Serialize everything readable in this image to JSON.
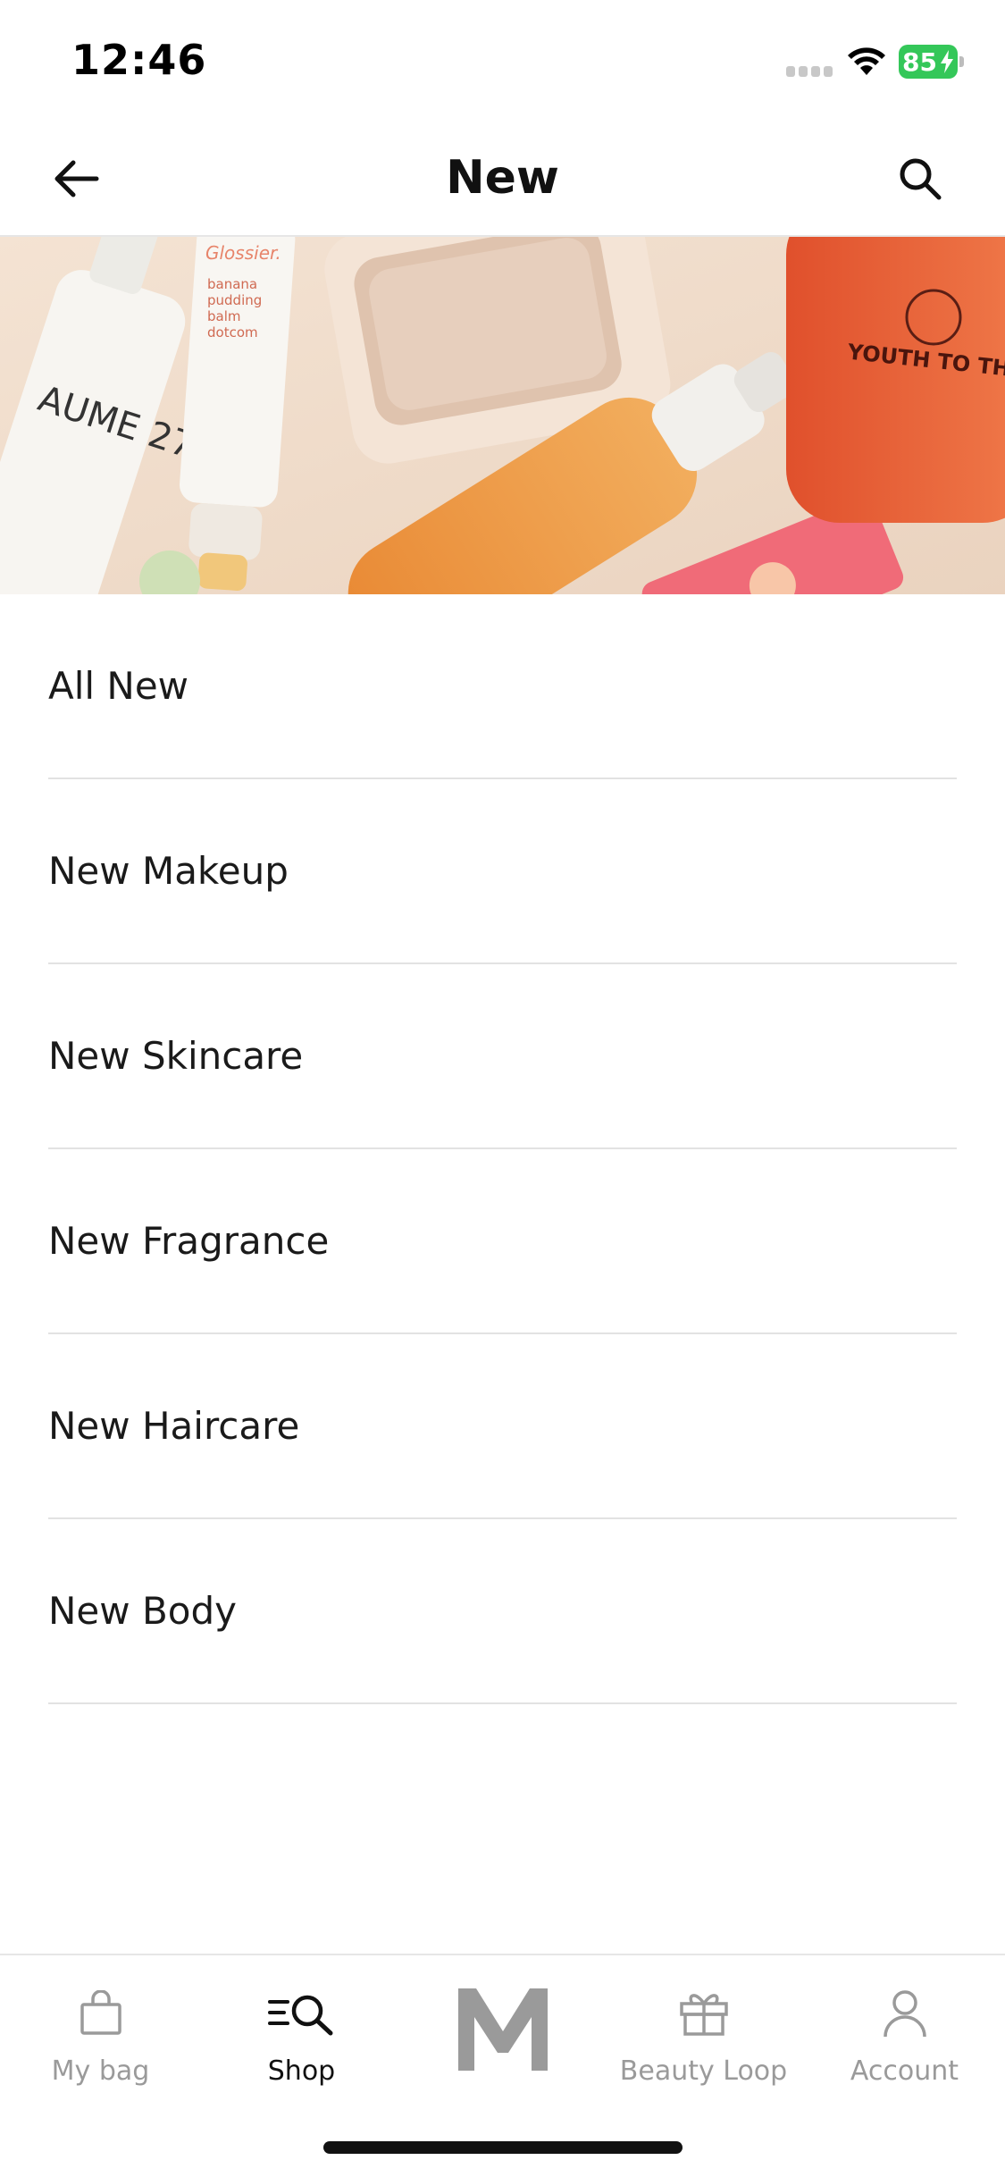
{
  "status_bar": {
    "time": "12:46",
    "battery": "85"
  },
  "header": {
    "title": "New",
    "back_icon": "arrow-left-icon",
    "search_icon": "search-icon"
  },
  "hero": {
    "products": [
      {
        "brand": "Glossier.",
        "lines": [
          "banana",
          "pudding",
          "balm",
          "dotcom"
        ]
      },
      {
        "brand": "AUME 27"
      },
      {
        "brand": "YOUTH TO THE PEOPLE"
      }
    ]
  },
  "categories": [
    {
      "label": "All New"
    },
    {
      "label": "New Makeup"
    },
    {
      "label": "New Skincare"
    },
    {
      "label": "New Fragrance"
    },
    {
      "label": "New Haircare"
    },
    {
      "label": "New Body"
    }
  ],
  "tab_bar": {
    "tabs": [
      {
        "label": "My bag",
        "icon": "shopping-bag-icon",
        "active": false
      },
      {
        "label": "Shop",
        "icon": "shop-search-icon",
        "active": true
      },
      {
        "label": "",
        "icon": "m-logo-icon",
        "active": false
      },
      {
        "label": "Beauty Loop",
        "icon": "gift-icon",
        "active": false
      },
      {
        "label": "Account",
        "icon": "person-icon",
        "active": false
      }
    ]
  },
  "colors": {
    "battery": "#34c759",
    "active_tab": "#111111",
    "inactive_tab": "#9a9a9a"
  }
}
